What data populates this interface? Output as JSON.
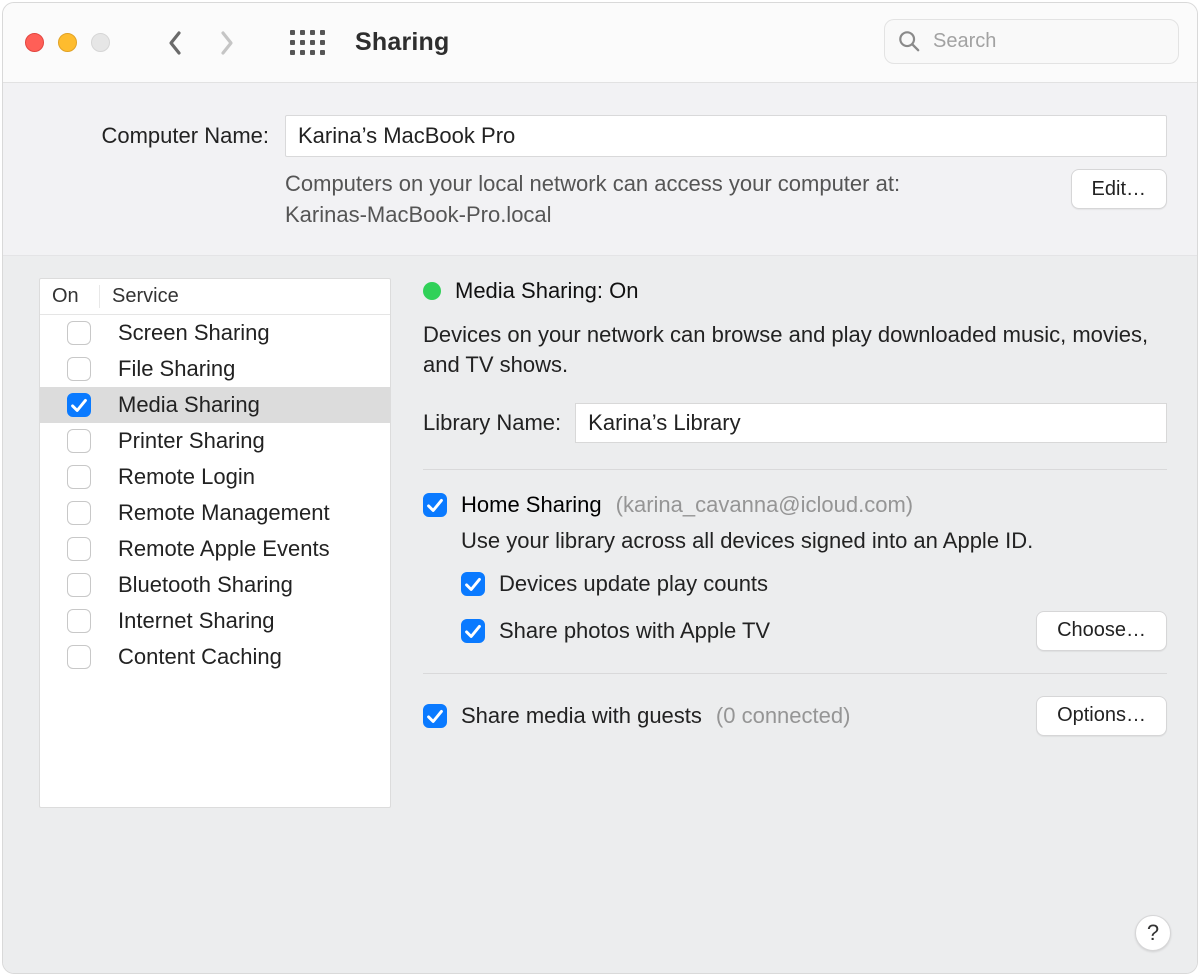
{
  "window": {
    "title": "Sharing",
    "search_placeholder": "Search"
  },
  "computer_name": {
    "label": "Computer Name:",
    "value": "Karina’s MacBook Pro",
    "hint_line1": "Computers on your local network can access your computer at:",
    "hint_line2": "Karinas-MacBook-Pro.local",
    "edit_label": "Edit…"
  },
  "sidebar": {
    "col_on": "On",
    "col_service": "Service",
    "items": [
      {
        "label": "Screen Sharing",
        "on": false,
        "selected": false
      },
      {
        "label": "File Sharing",
        "on": false,
        "selected": false
      },
      {
        "label": "Media Sharing",
        "on": true,
        "selected": true
      },
      {
        "label": "Printer Sharing",
        "on": false,
        "selected": false
      },
      {
        "label": "Remote Login",
        "on": false,
        "selected": false
      },
      {
        "label": "Remote Management",
        "on": false,
        "selected": false
      },
      {
        "label": "Remote Apple Events",
        "on": false,
        "selected": false
      },
      {
        "label": "Bluetooth Sharing",
        "on": false,
        "selected": false
      },
      {
        "label": "Internet Sharing",
        "on": false,
        "selected": false
      },
      {
        "label": "Content Caching",
        "on": false,
        "selected": false
      }
    ]
  },
  "detail": {
    "status_label": "Media Sharing: On",
    "status_on": true,
    "description": "Devices on your network can browse and play downloaded music, movies, and TV shows.",
    "library_label": "Library Name:",
    "library_value": "Karina’s Library",
    "home_sharing": {
      "checked": true,
      "label": "Home Sharing",
      "account": "(karina_cavanna@icloud.com)",
      "subtext": "Use your library across all devices signed into an Apple ID.",
      "play_counts": {
        "checked": true,
        "label": "Devices update play counts"
      },
      "share_photos": {
        "checked": true,
        "label": "Share photos with Apple TV",
        "button": "Choose…"
      }
    },
    "guests": {
      "checked": true,
      "label": "Share media with guests",
      "connected": "(0 connected)",
      "button": "Options…"
    }
  },
  "help_label": "?"
}
